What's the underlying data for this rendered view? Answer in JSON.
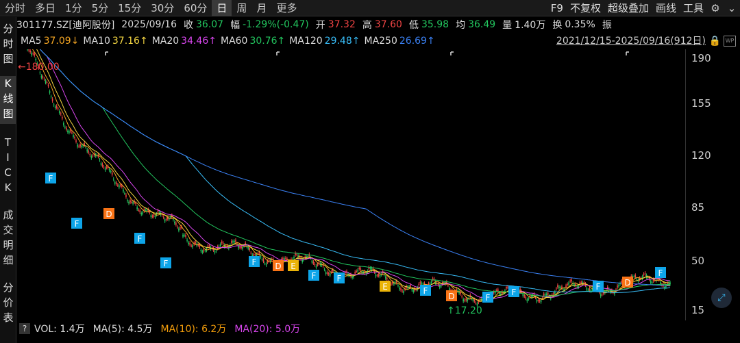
{
  "toolbar": {
    "tabs": [
      "分时",
      "多日",
      "1分",
      "5分",
      "15分",
      "30分",
      "60分",
      "日",
      "周",
      "月",
      "更多"
    ],
    "active_tab": "日",
    "right_items": [
      "F9",
      "不复权",
      "超级叠加",
      "画线",
      "工具"
    ]
  },
  "leftnav": {
    "items": [
      "分时图",
      "K线图",
      "TICK",
      "成交明细",
      "分价表"
    ],
    "active": "K线图"
  },
  "info": {
    "code": "301177.SZ[迪阿股份]",
    "date": "2025/09/16",
    "close_label": "收",
    "close": "36.07",
    "chg_label": "幅",
    "chg": "-1.29%(-0.47)",
    "open_label": "开",
    "open": "37.32",
    "high_label": "高",
    "high": "37.60",
    "low_label": "低",
    "low": "35.98",
    "avg_label": "均",
    "avg": "36.49",
    "vol_label": "量",
    "vol": "1.40万",
    "turn_label": "换",
    "turn": "0.35%",
    "amp_label": "振"
  },
  "ma": {
    "items": [
      {
        "label": "MA5",
        "value": "37.09↓",
        "color": "#f5a623"
      },
      {
        "label": "MA10",
        "value": "37.16↑",
        "color": "#f5d742"
      },
      {
        "label": "MA20",
        "value": "34.46↑",
        "color": "#d946ef"
      },
      {
        "label": "MA60",
        "value": "30.76↑",
        "color": "#22c55e"
      },
      {
        "label": "MA120",
        "value": "29.48↑",
        "color": "#38bdf8"
      },
      {
        "label": "MA250",
        "value": "26.69↑",
        "color": "#3b82f6"
      }
    ],
    "date_range": "2021/12/15-2025/09/16(912日)"
  },
  "chart": {
    "yticks": [
      "190",
      "155",
      "120",
      "85",
      "50",
      "15"
    ],
    "high_annotation": "←180.00",
    "low_annotation": "↑17.20",
    "markers": [
      {
        "t": "F",
        "c": "#0ea5e9"
      },
      {
        "t": "F",
        "c": "#0ea5e9"
      },
      {
        "t": "D",
        "c": "#f97316"
      },
      {
        "t": "F",
        "c": "#0ea5e9"
      },
      {
        "t": "F",
        "c": "#0ea5e9"
      },
      {
        "t": "F",
        "c": "#0ea5e9"
      },
      {
        "t": "D",
        "c": "#f97316"
      },
      {
        "t": "E",
        "c": "#eab308"
      },
      {
        "t": "F",
        "c": "#0ea5e9"
      },
      {
        "t": "F",
        "c": "#0ea5e9"
      },
      {
        "t": "E",
        "c": "#eab308"
      },
      {
        "t": "F",
        "c": "#0ea5e9"
      },
      {
        "t": "D",
        "c": "#f97316"
      },
      {
        "t": "F",
        "c": "#0ea5e9"
      },
      {
        "t": "F",
        "c": "#0ea5e9"
      },
      {
        "t": "F",
        "c": "#0ea5e9"
      },
      {
        "t": "D",
        "c": "#f97316"
      },
      {
        "t": "F",
        "c": "#0ea5e9"
      }
    ]
  },
  "volume": {
    "help": "?",
    "vol": "VOL: 1.4万",
    "ma5": "MA(5): 4.5万",
    "ma10": "MA(10): 6.2万",
    "ma20": "MA(20): 5.0万"
  }
}
